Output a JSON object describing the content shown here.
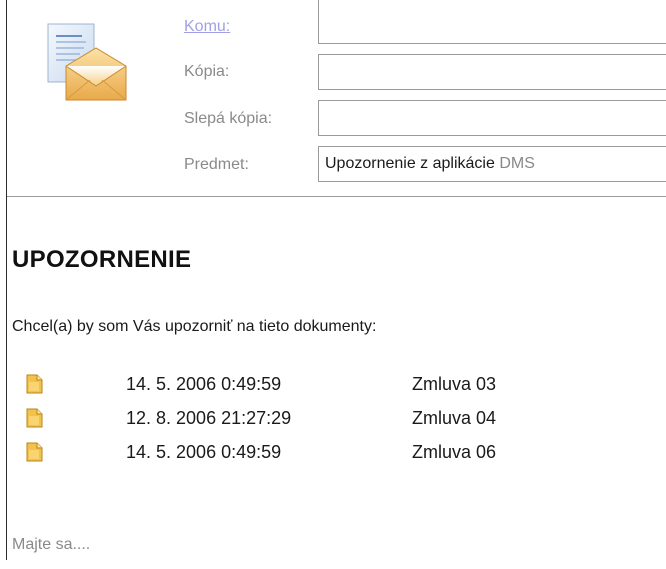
{
  "header": {
    "to_label": "Komu:",
    "cc_label": "Kópia:",
    "bcc_label": "Slepá kópia:",
    "subject_label": "Predmet:",
    "to_value": "",
    "cc_value": "",
    "bcc_value": "",
    "subject_value_main": "Upozornenie z aplikácie ",
    "subject_value_tail": "DMS"
  },
  "body": {
    "heading": "UPOZORNENIE",
    "intro": "Chcel(a) by som Vás upozorniť na tieto dokumenty:",
    "documents": [
      {
        "date": "14. 5. 2006 0:49:59",
        "name": "Zmluva 03",
        "icon": "document-icon"
      },
      {
        "date": "12. 8. 2006 21:27:29",
        "name": "Zmluva 04",
        "icon": "document-icon"
      },
      {
        "date": "14. 5. 2006 0:49:59",
        "name": "Zmluva 06",
        "icon": "document-icon"
      }
    ],
    "closing": "Majte sa...."
  },
  "icons": {
    "envelope": "email-envelope-icon",
    "document": "document-icon"
  },
  "colors": {
    "link_label": "#a0a0e8",
    "muted_label": "#8a8a8a",
    "document_yellow": "#f2c24a"
  }
}
